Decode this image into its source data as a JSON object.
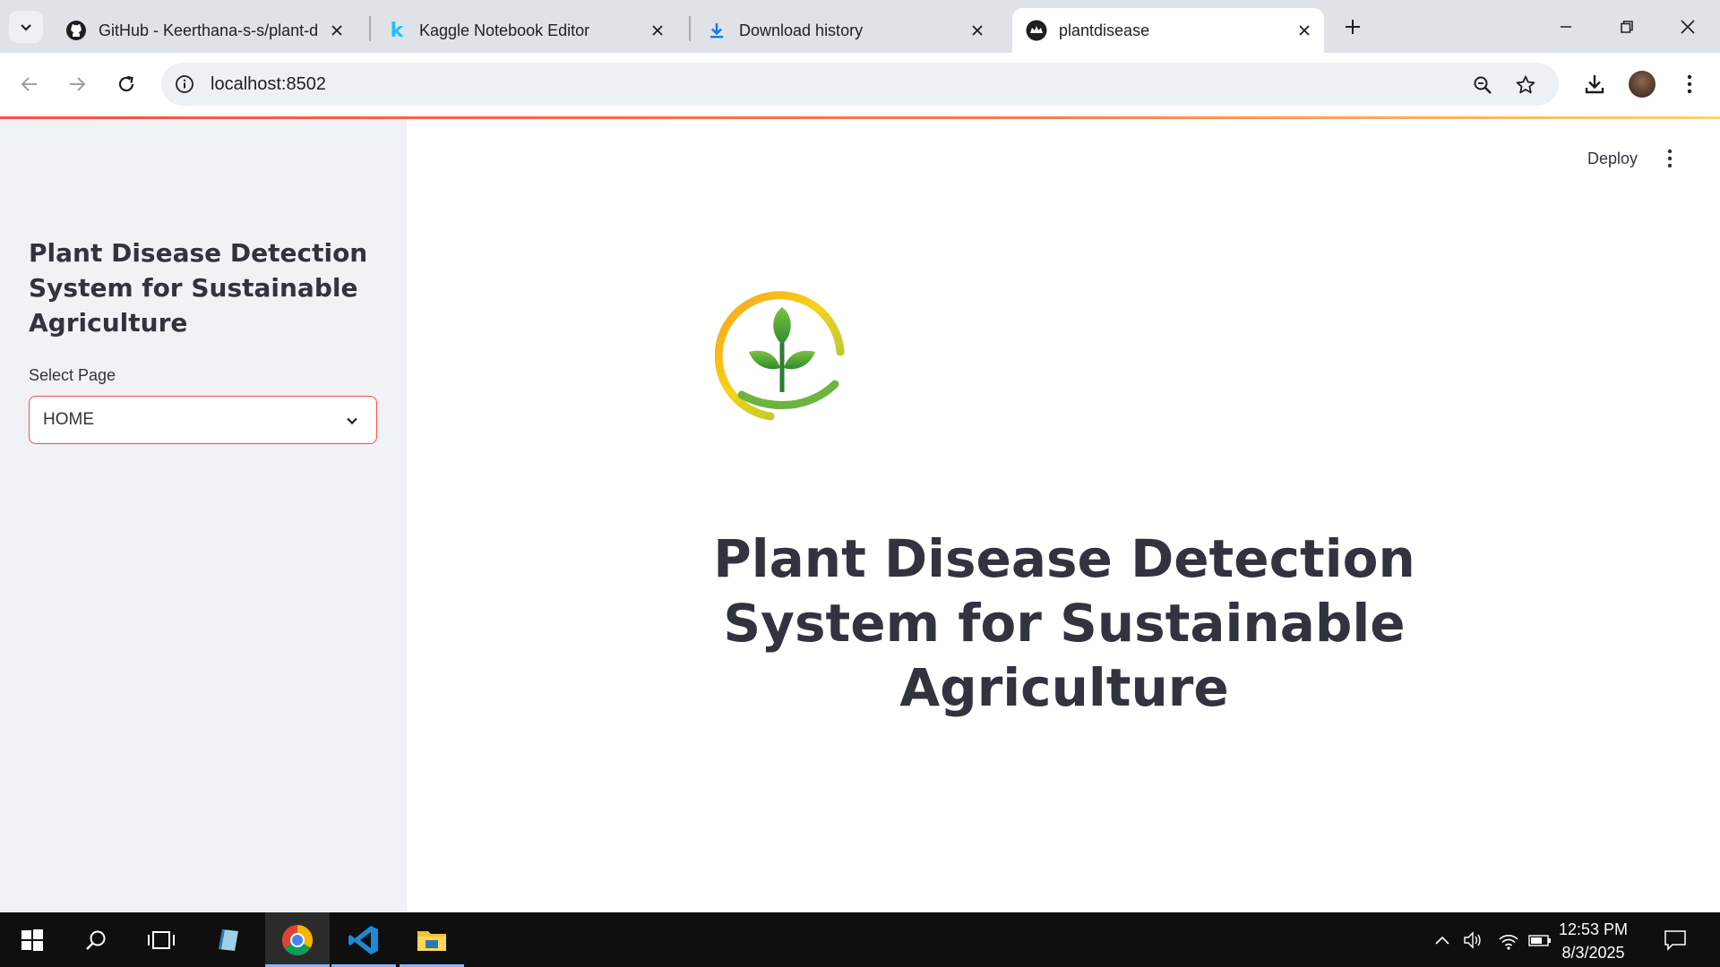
{
  "browser": {
    "tabs": [
      {
        "title": "GitHub - Keerthana-s-s/plant-d",
        "icon": "github-icon"
      },
      {
        "title": "Kaggle Notebook Editor",
        "icon": "kaggle-icon"
      },
      {
        "title": "Download history",
        "icon": "download-icon"
      },
      {
        "title": "plantdisease",
        "icon": "streamlit-icon",
        "active": true
      }
    ],
    "url": "localhost:8502"
  },
  "sidebar": {
    "title": "Plant Disease Detection System for Sustainable Agriculture",
    "select_label": "Select Page",
    "select_value": "HOME"
  },
  "main": {
    "deploy_label": "Deploy",
    "title": "Plant Disease Detection System for Sustainable Agriculture",
    "logo": "plant-hand-logo"
  },
  "taskbar": {
    "time": "12:53 PM",
    "date": "8/3/2025",
    "apps": [
      "start-icon",
      "search-icon",
      "task-view-icon",
      "notepad-icon",
      "chrome-icon",
      "vscode-icon",
      "file-explorer-icon"
    ]
  },
  "colors": {
    "accent": "#ff4b4b",
    "sidebar_bg": "#f0f2f6",
    "text": "#31333f"
  }
}
